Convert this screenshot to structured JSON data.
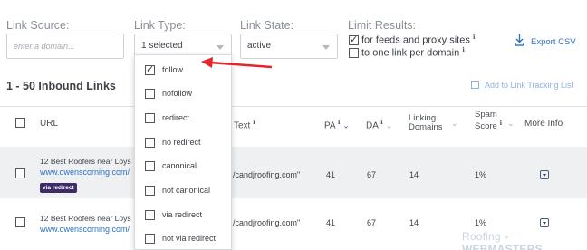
{
  "filters": {
    "source_label": "Link Source:",
    "source_placeholder": "enter a domain...",
    "type_label": "Link Type:",
    "type_value": "1 selected",
    "state_label": "Link State:",
    "state_value": "active",
    "limit_label": "Limit Results:",
    "limit_feeds": "for feeds and proxy sites",
    "limit_feeds_checked": true,
    "limit_domain": "to one link per domain",
    "limit_domain_checked": false,
    "info_symbol": "ℹ",
    "export_label": "Export CSV",
    "export_icon": "download-icon"
  },
  "summary": {
    "count": "1 - 50 Inbound Links",
    "add_tracking": "Add to Link Tracking List"
  },
  "columns": {
    "url": "URL",
    "text": "Text",
    "pa": "PA",
    "da": "DA",
    "linking_1": "Linking",
    "linking_2": "Domains",
    "spam_1": "Spam",
    "spam_2": "Score",
    "more": "More Info"
  },
  "rows": [
    {
      "title": "12 Best Roofers near Loys",
      "link": "www.owenscorning.com/",
      "badge": "via redirect",
      "text": "/candjroofing.com\"",
      "pa": "41",
      "da": "67",
      "linking": "14",
      "spam": "1%"
    },
    {
      "title": "12 Best Roofers near Loys",
      "link": "www.owenscorning.com/",
      "badge": "",
      "text": "/candjroofing.com\"",
      "pa": "41",
      "da": "67",
      "linking": "14",
      "spam": "1%"
    }
  ],
  "dropdown_options": [
    {
      "label": "follow",
      "checked": true
    },
    {
      "label": "nofollow",
      "checked": false
    },
    {
      "label": "redirect",
      "checked": false
    },
    {
      "label": "no redirect",
      "checked": false
    },
    {
      "label": "canonical",
      "checked": false
    },
    {
      "label": "not canonical",
      "checked": false
    },
    {
      "label": "via redirect",
      "checked": false
    },
    {
      "label": "not via redirect",
      "checked": false
    }
  ],
  "watermark": {
    "part1": "Roofing",
    "part2": "WEBMASTERS"
  },
  "colors": {
    "arrow": "#e3262b",
    "link": "#2b72c2",
    "badge": "#3c2b66"
  }
}
